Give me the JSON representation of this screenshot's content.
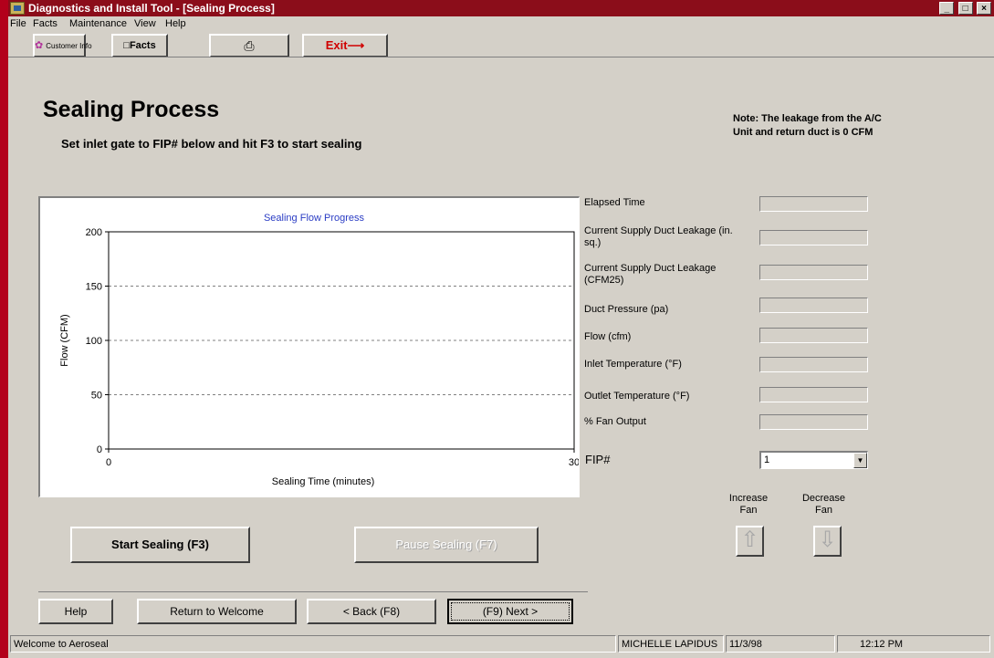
{
  "window": {
    "title": "Diagnostics and Install Tool - [Sealing Process]",
    "buttons": [
      "_",
      "8",
      "×"
    ]
  },
  "menu": [
    "File",
    "Facts",
    "Maintenance",
    "View",
    "Help"
  ],
  "toolbar": {
    "customer_info": "Customer Info",
    "facts": "Facts",
    "print_icon": "printer-icon",
    "exit": "Exit⟶"
  },
  "page": {
    "title": "Sealing Process",
    "instruction": "Set inlet gate to FIP# below and hit F3 to start sealing",
    "note_line1": "Note: The leakage from the A/C",
    "note_line2": "Unit and return duct is 0 CFM"
  },
  "chart_data": {
    "type": "line",
    "title": "Sealing Flow Progress",
    "xlabel": "Sealing Time (minutes)",
    "ylabel": "Flow (CFM)",
    "xlim": [
      0,
      30
    ],
    "ylim": [
      0,
      200
    ],
    "xticks": [
      0,
      30
    ],
    "yticks": [
      0,
      50,
      100,
      150,
      200
    ],
    "grid": "horizontal dashed",
    "series": []
  },
  "fields": [
    {
      "label": "Elapsed Time",
      "value": ""
    },
    {
      "label": "Current Supply Duct Leakage (in. sq.)",
      "value": ""
    },
    {
      "label": "Current Supply Duct Leakage (CFM25)",
      "value": ""
    },
    {
      "label": "Duct Pressure (pa)",
      "value": ""
    },
    {
      "label": "Flow (cfm)",
      "value": ""
    },
    {
      "label": "Inlet Temperature (°F)",
      "value": ""
    },
    {
      "label": "Outlet Temperature (°F)",
      "value": ""
    },
    {
      "label": "% Fan Output",
      "value": ""
    }
  ],
  "fip": {
    "label": "FIP#",
    "value": "1"
  },
  "fan": {
    "increase_line1": "Increase",
    "increase_line2": "Fan",
    "decrease_line1": "Decrease",
    "decrease_line2": "Fan"
  },
  "actions": {
    "start": "Start Sealing (F3)",
    "pause": "Pause Sealing (F7)"
  },
  "nav": {
    "help": "Help",
    "return": "Return to Welcome",
    "back": "< Back (F8)",
    "next": "(F9) Next >"
  },
  "status": {
    "message": "Welcome to Aeroseal",
    "user": "MICHELLE LAPIDUS",
    "date": "11/3/98",
    "time": "12:12 PM"
  }
}
